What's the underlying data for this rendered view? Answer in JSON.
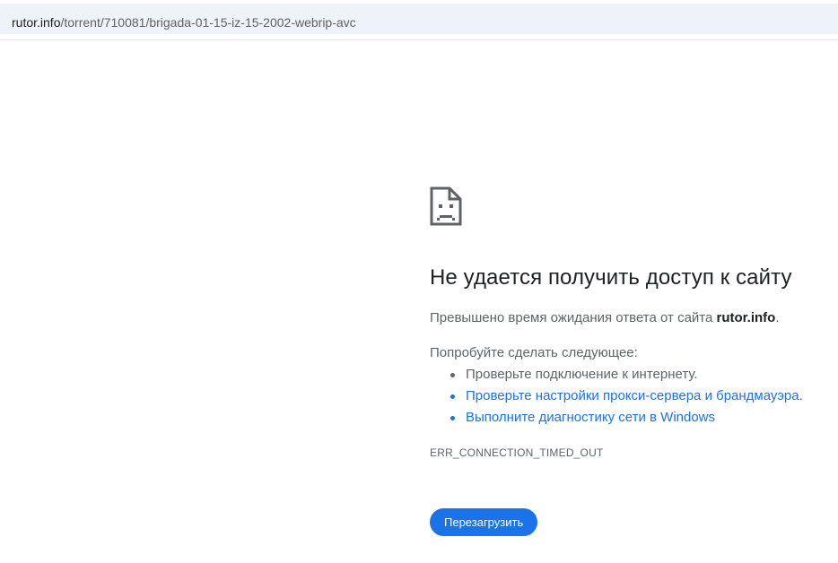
{
  "address_bar": {
    "host": "rutor.info",
    "path": "/torrent/710081/brigada-01-15-iz-15-2002-webrip-avc"
  },
  "error_page": {
    "icon": "sad-page-icon",
    "title": "Не удается получить доступ к сайту",
    "summary_prefix": "Превышено время ожидания ответа от сайта ",
    "summary_host": "rutor.info",
    "summary_suffix": ".",
    "suggestions_title": "Попробуйте сделать следующее:",
    "suggestions": [
      {
        "text": "Проверьте подключение к интернету.",
        "is_link": false
      },
      {
        "text": "Проверьте настройки прокси-сервера и брандмауэра.",
        "is_link": true
      },
      {
        "text": "Выполните диагностику сети в Windows",
        "is_link": true
      }
    ],
    "error_code": "ERR_CONNECTION_TIMED_OUT",
    "reload_label": "Перезагрузить"
  },
  "colors": {
    "accent": "#1a73e8",
    "text_secondary": "#5f6368",
    "text_primary": "#202124",
    "urlbar_bg": "#eef2f9"
  }
}
